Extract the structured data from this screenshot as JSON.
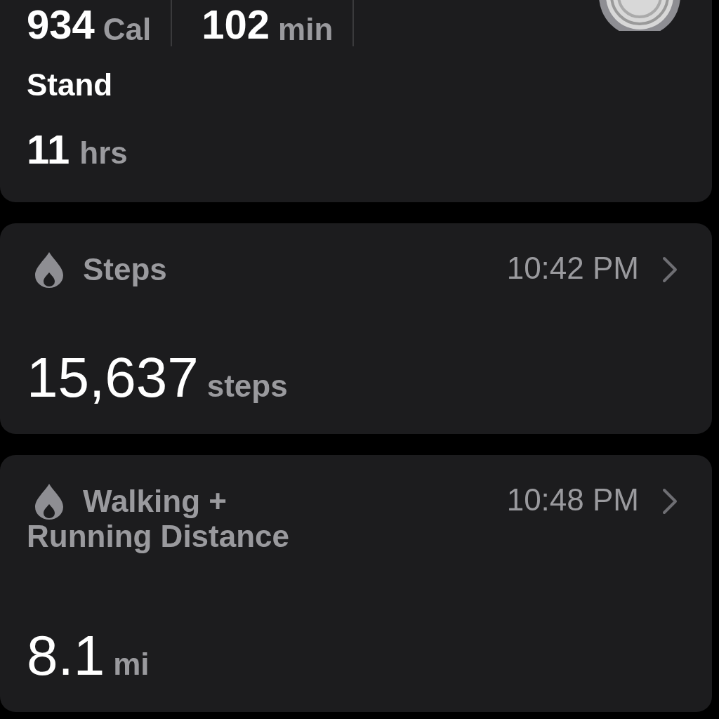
{
  "summary": {
    "stats": [
      {
        "value": "934",
        "unit": "Cal"
      },
      {
        "value": "102",
        "unit": "min"
      }
    ],
    "stand": {
      "label": "Stand",
      "value": "11",
      "unit": "hrs"
    }
  },
  "cards": [
    {
      "title_lines": [
        "Steps"
      ],
      "time": "10:42 PM",
      "value": "15,637",
      "unit": "steps"
    },
    {
      "title_lines": [
        "Walking +",
        "Running Distance"
      ],
      "time": "10:48 PM",
      "value": "8.1",
      "unit": "mi"
    }
  ]
}
